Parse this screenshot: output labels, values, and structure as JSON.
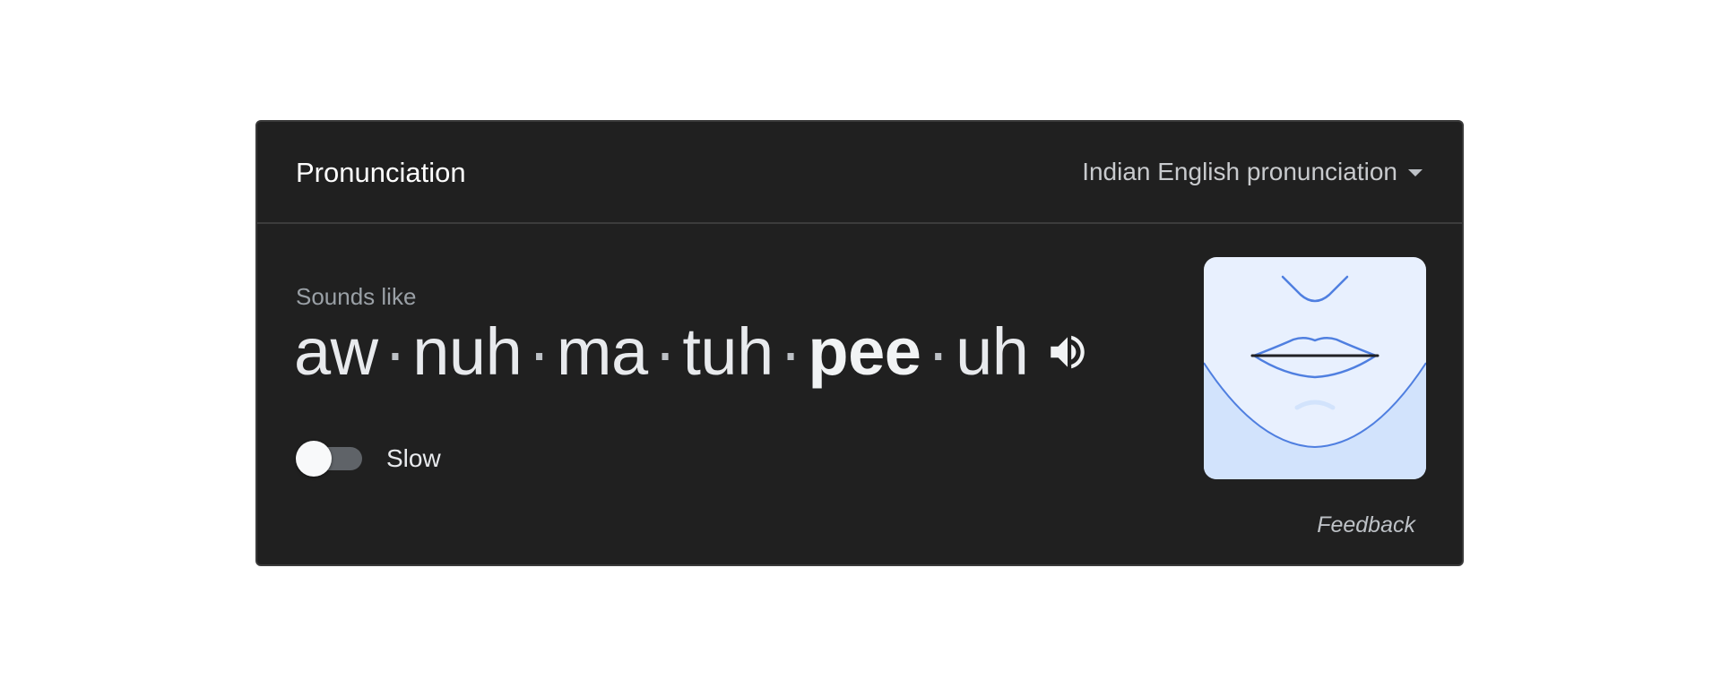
{
  "card": {
    "title": "Pronunciation",
    "language_select": {
      "selected": "Indian English pronunciation"
    },
    "sounds_like_label": "Sounds like",
    "syllables": [
      {
        "text": "aw",
        "stressed": false
      },
      {
        "text": "nuh",
        "stressed": false
      },
      {
        "text": "ma",
        "stressed": false
      },
      {
        "text": "tuh",
        "stressed": false
      },
      {
        "text": "pee",
        "stressed": true
      },
      {
        "text": "uh",
        "stressed": false
      }
    ],
    "separator": "·",
    "slow_toggle": {
      "label": "Slow",
      "on": false
    },
    "feedback_label": "Feedback"
  },
  "icons": {
    "speaker": "speaker-icon",
    "dropdown": "chevron-down-icon",
    "mouth_illustration": "mouth-illustration"
  },
  "colors": {
    "card_background": "#202020",
    "illustration_background": "#e8f0fe",
    "illustration_line": "#4f7fe0"
  }
}
